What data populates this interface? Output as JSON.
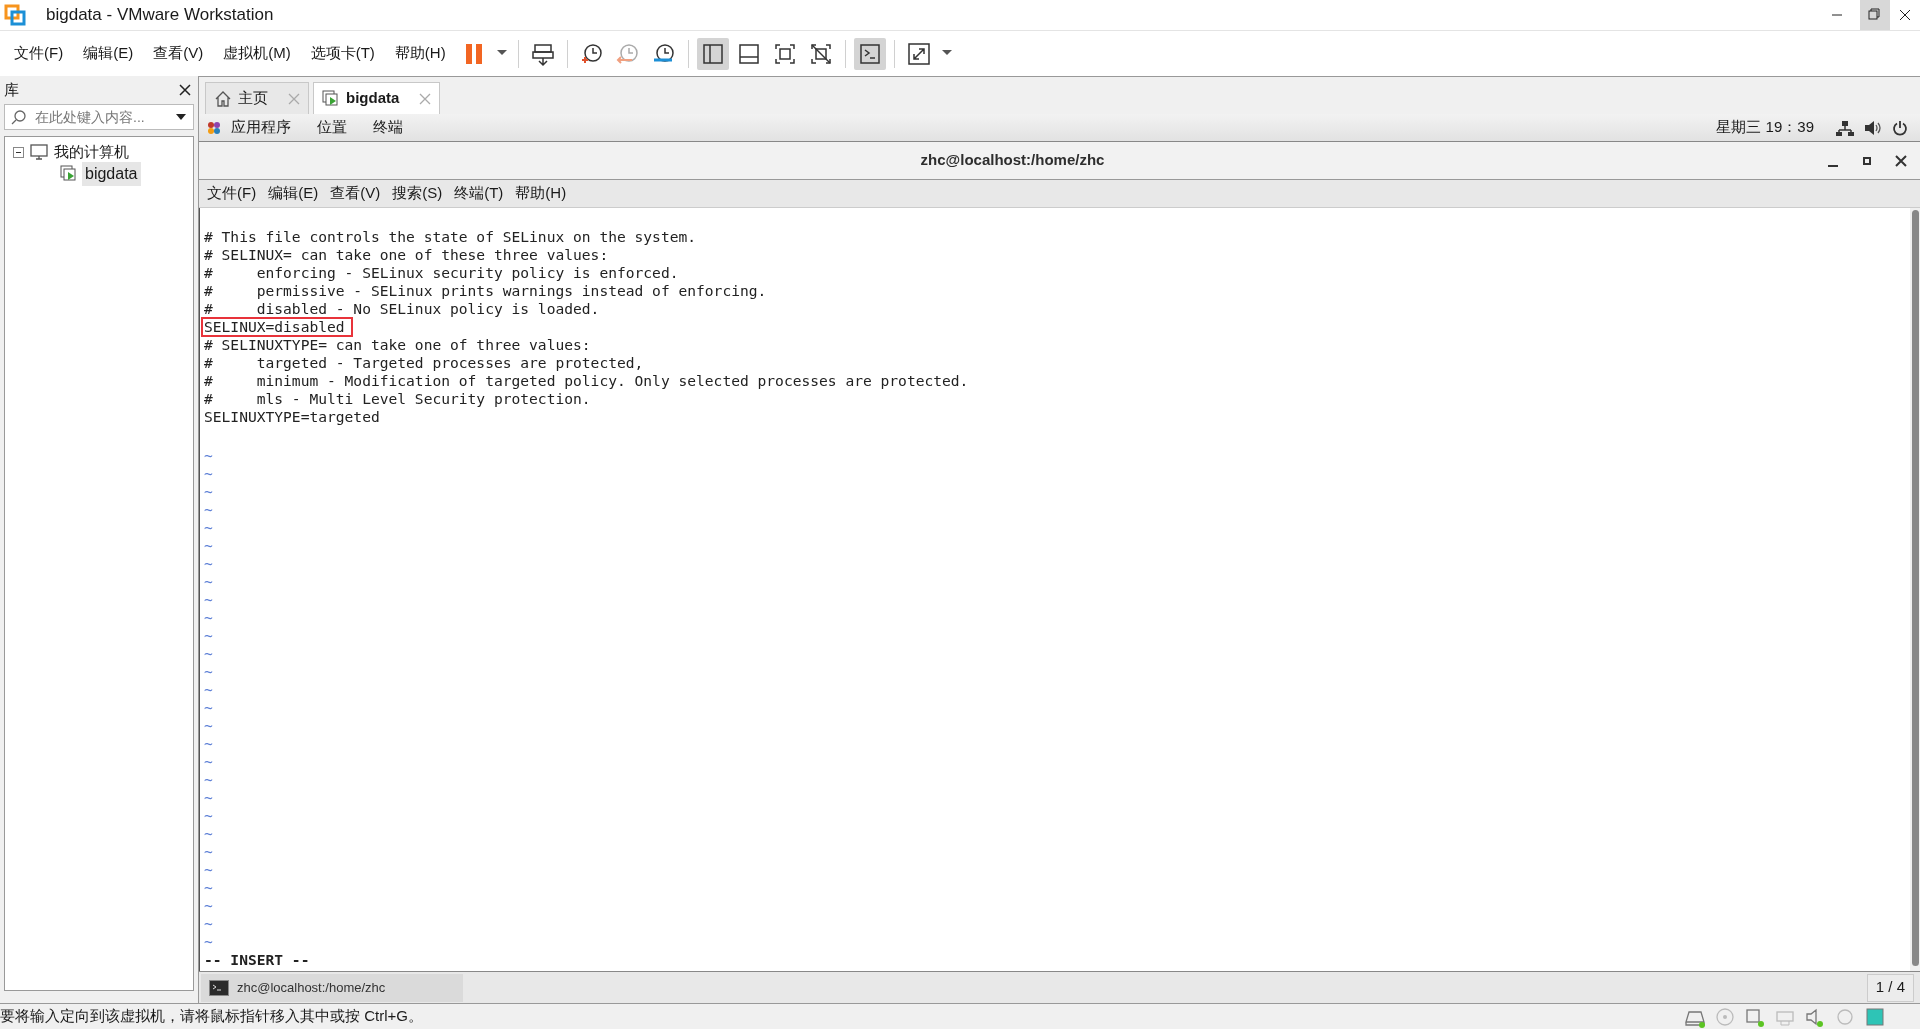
{
  "window": {
    "title": "bigdata - VMware Workstation"
  },
  "menu": [
    "文件(F)",
    "编辑(E)",
    "查看(V)",
    "虚拟机(M)",
    "选项卡(T)",
    "帮助(H)"
  ],
  "toolbar": [
    {
      "kind": "pause",
      "selected": false
    },
    {
      "kind": "caret",
      "selected": false
    },
    {
      "kind": "sep"
    },
    {
      "kind": "send",
      "selected": false
    },
    {
      "kind": "sep"
    },
    {
      "kind": "snap",
      "selected": false
    },
    {
      "kind": "revert",
      "selected": false
    },
    {
      "kind": "manage",
      "selected": false
    },
    {
      "kind": "sep"
    },
    {
      "kind": "sidebar",
      "selected": true
    },
    {
      "kind": "bottom",
      "selected": false
    },
    {
      "kind": "fit",
      "selected": false
    },
    {
      "kind": "nofit",
      "selected": false
    },
    {
      "kind": "sep"
    },
    {
      "kind": "console",
      "selected": true
    },
    {
      "kind": "sep"
    },
    {
      "kind": "fullscreen",
      "selected": false
    },
    {
      "kind": "caret",
      "selected": false
    }
  ],
  "library": {
    "title": "库",
    "search": {
      "placeholder": "在此处键入内容..."
    },
    "tree": [
      {
        "label": "我的计算机",
        "expanded": true,
        "children": [
          {
            "label": "bigdata",
            "selected": true
          }
        ]
      }
    ]
  },
  "tabs": [
    {
      "label": "主页",
      "kind": "home",
      "selected": false
    },
    {
      "label": "bigdata",
      "kind": "vm",
      "selected": true
    }
  ],
  "guest_bar": {
    "items": [
      "应用程序",
      "位置",
      "终端"
    ],
    "clock": "星期三 19：39"
  },
  "terminal": {
    "title": "zhc@localhost:/home/zhc",
    "menu": [
      "文件(F)",
      "编辑(E)",
      "查看(V)",
      "搜索(S)",
      "终端(T)",
      "帮助(H)"
    ],
    "lines": [
      {
        "text": "# This file controls the state of SELinux on the system.",
        "highlighted": false
      },
      {
        "text": "# SELINUX= can take one of these three values:",
        "highlighted": false
      },
      {
        "text": "#     enforcing - SELinux security policy is enforced.",
        "highlighted": false
      },
      {
        "text": "#     permissive - SELinux prints warnings instead of enforcing.",
        "highlighted": false
      },
      {
        "text": "#     disabled - No SELinux policy is loaded.",
        "highlighted": false
      },
      {
        "text": "SELINUX=disabled",
        "highlighted": true
      },
      {
        "text": "# SELINUXTYPE= can take one of three values:",
        "highlighted": false
      },
      {
        "text": "#     targeted - Targeted processes are protected,",
        "highlighted": false
      },
      {
        "text": "#     minimum - Modification of targeted policy. Only selected processes are protected.",
        "highlighted": false
      },
      {
        "text": "#     mls - Multi Level Security protection.",
        "highlighted": false
      },
      {
        "text": "SELINUXTYPE=targeted",
        "highlighted": false
      }
    ],
    "tildes": [
      "~",
      "~",
      "~",
      "~",
      "~",
      "~",
      "~",
      "~",
      "~",
      "~",
      "~",
      "~",
      "~",
      "~",
      "~",
      "~",
      "~",
      "~",
      "~",
      "~",
      "~",
      "~",
      "~",
      "~",
      "~",
      "~",
      "~",
      "~"
    ],
    "mode": "-- INSERT --"
  },
  "taskbar": {
    "item": "zhc@localhost:/home/zhc",
    "pager": "1 / 4"
  },
  "status_bar": "要将输入定向到该虚拟机，请将鼠标指针移入其中或按 Ctrl+G。"
}
